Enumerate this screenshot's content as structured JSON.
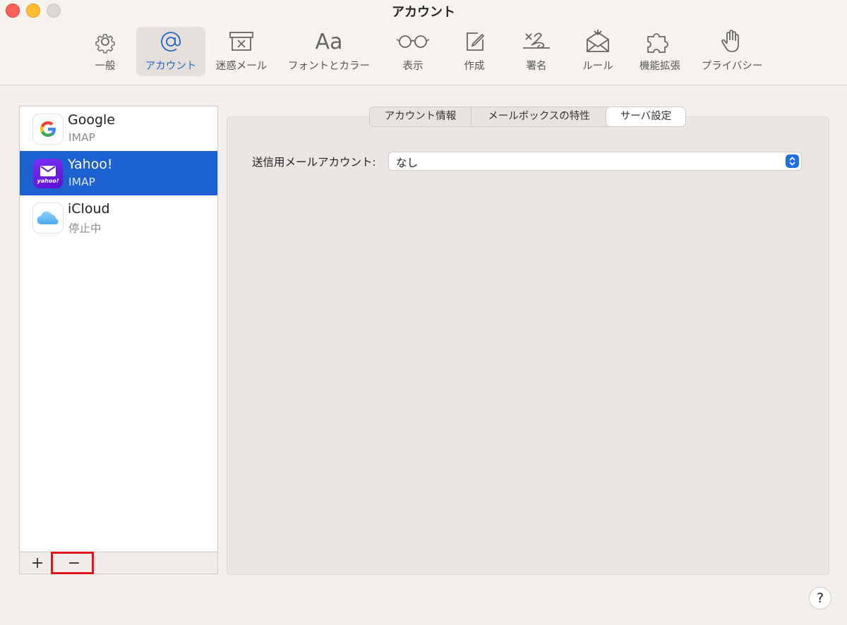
{
  "window": {
    "title": "アカウント"
  },
  "toolbar": {
    "items": [
      {
        "label": "一般",
        "icon": "gear-icon"
      },
      {
        "label": "アカウント",
        "icon": "at-sign-icon",
        "active": true
      },
      {
        "label": "迷惑メール",
        "icon": "junk-box-icon"
      },
      {
        "label": "フォントとカラー",
        "icon_text": "Aa",
        "icon": "fonts-icon"
      },
      {
        "label": "表示",
        "icon": "glasses-icon"
      },
      {
        "label": "作成",
        "icon": "compose-icon"
      },
      {
        "label": "署名",
        "icon": "signature-icon"
      },
      {
        "label": "ルール",
        "icon": "rules-envelope-icon"
      },
      {
        "label": "機能拡張",
        "icon": "puzzle-icon"
      },
      {
        "label": "プライバシー",
        "icon": "hand-icon"
      }
    ]
  },
  "accounts": [
    {
      "name": "Google",
      "type": "IMAP",
      "icon": "google-logo-icon"
    },
    {
      "name": "Yahoo!",
      "type": "IMAP",
      "icon": "yahoo-mail-icon",
      "icon_text": "yahoo!",
      "selected": true
    },
    {
      "name": "iCloud",
      "type": "停止中",
      "icon": "icloud-icon"
    }
  ],
  "list_footer": {
    "add": "+",
    "remove": "−"
  },
  "tabs": [
    {
      "label": "アカウント情報"
    },
    {
      "label": "メールボックスの特性"
    },
    {
      "label": "サーバ設定",
      "active": true
    }
  ],
  "server_settings": {
    "outgoing_label": "送信用メールアカウント:",
    "outgoing_value": "なし"
  },
  "help": {
    "label": "?"
  },
  "colors": {
    "accent": "#1b62d0",
    "highlight": "#e0141e",
    "yahoo_purple": "#6001d2"
  }
}
